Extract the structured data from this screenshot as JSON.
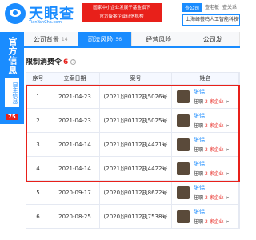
{
  "header": {
    "logo_text": "天眼查",
    "logo_sub": "TianYanCha.com",
    "banner_line1": "国家中小企业发展子基金旗下",
    "banner_line2": "官方备案企业征信机构",
    "company_tabs": [
      "查公司",
      "查老板",
      "查关系"
    ],
    "company_value": "上海峰荟鸣人工智能科技有限公司"
  },
  "side": {
    "title": "官方信息",
    "sub": "自主信息",
    "badge": "75"
  },
  "tabs": [
    {
      "label": "公司背景",
      "count": "14",
      "active": false
    },
    {
      "label": "司法风险",
      "count": "56",
      "active": true
    },
    {
      "label": "经营风险",
      "count": "",
      "active": false
    },
    {
      "label": "公司发",
      "count": "",
      "active": false
    }
  ],
  "section": {
    "title": "限制消费令",
    "count": "6",
    "info_icon": "?"
  },
  "table": {
    "headers": [
      "序号",
      "立案日期",
      "案号",
      "姓名"
    ],
    "rows": [
      {
        "idx": "1",
        "date": "2021-04-23",
        "case": "(2021)沪0112执5026号",
        "name": "张惕",
        "role_prefix": "任职",
        "role_link": "2 家企业",
        "role_suffix": ">"
      },
      {
        "idx": "2",
        "date": "2021-04-23",
        "case": "(2021)沪0112执5025号",
        "name": "张惕",
        "role_prefix": "任职",
        "role_link": "2 家企业",
        "role_suffix": ">"
      },
      {
        "idx": "3",
        "date": "2021-04-14",
        "case": "(2021)沪0112执4421号",
        "name": "张惕",
        "role_prefix": "任职",
        "role_link": "2 家企业",
        "role_suffix": ">"
      },
      {
        "idx": "4",
        "date": "2021-04-14",
        "case": "(2021)沪0112执4422号",
        "name": "张惕",
        "role_prefix": "任职",
        "role_link": "2 家企业",
        "role_suffix": ">"
      },
      {
        "idx": "5",
        "date": "2020-09-17",
        "case": "(2020)沪0112执8622号",
        "name": "张惕",
        "role_prefix": "任职",
        "role_link": "2 家企业",
        "role_suffix": ">"
      },
      {
        "idx": "6",
        "date": "2020-08-25",
        "case": "(2020)沪0112执7538号",
        "name": "张惕",
        "role_prefix": "任职",
        "role_link": "2 家企业",
        "role_suffix": ">"
      }
    ]
  },
  "colors": {
    "brand": "#1a8cff",
    "alert": "#e8201a"
  }
}
